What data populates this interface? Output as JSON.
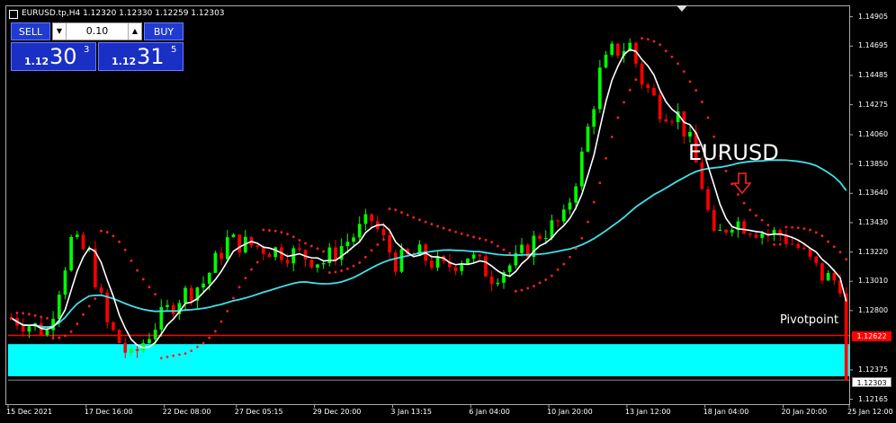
{
  "header": {
    "symbol_line": "EURUSD.tp,H4  1.12320 1.12330 1.12259 1.12303"
  },
  "trade_panel": {
    "sell_label": "SELL",
    "buy_label": "BUY",
    "lot_value": "0.10",
    "sell_price": {
      "small": "1.12",
      "big": "30",
      "sup": "3"
    },
    "buy_price": {
      "small": "1.12",
      "big": "31",
      "sup": "5"
    }
  },
  "overlay": {
    "title": "EURUSD",
    "pivot_label": "Pivotpoint",
    "arrow_icon": "down-arrow-icon",
    "red_tag": "1.12622",
    "white_tag": "1.12303"
  },
  "colors": {
    "background": "#000000",
    "bull_candle": "#00ff00",
    "bear_candle": "#ff0000",
    "fast_ma": "#ffffff",
    "slow_ma": "#40e0e8",
    "sar": "#ff2020",
    "pivot_line": "#ff0000",
    "zone": "#00ffff"
  },
  "chart_data": {
    "type": "candlestick",
    "title": "EURUSD.tp,H4",
    "y_ticks": [
      "1.14905",
      "1.14695",
      "1.14485",
      "1.14275",
      "1.14060",
      "1.13850",
      "1.13640",
      "1.13430",
      "1.13220",
      "1.13010",
      "1.12800",
      "1.12375",
      "1.12165"
    ],
    "x_ticks": [
      "15 Dec 2021",
      "17 Dec 16:00",
      "22 Dec 08:00",
      "27 Dec 05:15",
      "29 Dec 20:00",
      "3 Jan 13:15",
      "6 Jan 04:00",
      "10 Jan 20:00",
      "13 Jan 12:00",
      "18 Jan 04:00",
      "20 Jan 20:00",
      "25 Jan 12:00"
    ],
    "ylim": [
      1.1213,
      1.1498
    ],
    "n_bars": 140,
    "close_path": [
      [
        0,
        1.1275
      ],
      [
        6,
        1.1265
      ],
      [
        10,
        1.133
      ],
      [
        13,
        1.132
      ],
      [
        16,
        1.127
      ],
      [
        20,
        1.1245
      ],
      [
        24,
        1.127
      ],
      [
        28,
        1.129
      ],
      [
        32,
        1.13
      ],
      [
        36,
        1.133
      ],
      [
        42,
        1.1325
      ],
      [
        48,
        1.132
      ],
      [
        52,
        1.1315
      ],
      [
        56,
        1.133
      ],
      [
        60,
        1.1345
      ],
      [
        64,
        1.1315
      ],
      [
        68,
        1.132
      ],
      [
        72,
        1.131
      ],
      [
        76,
        1.132
      ],
      [
        80,
        1.1305
      ],
      [
        84,
        1.1315
      ],
      [
        88,
        1.1335
      ],
      [
        92,
        1.1345
      ],
      [
        95,
        1.139
      ],
      [
        98,
        1.145
      ],
      [
        100,
        1.1465
      ],
      [
        103,
        1.147
      ],
      [
        105,
        1.1445
      ],
      [
        108,
        1.1425
      ],
      [
        111,
        1.142
      ],
      [
        113,
        1.14
      ],
      [
        115,
        1.137
      ],
      [
        117,
        1.133
      ],
      [
        120,
        1.1345
      ],
      [
        123,
        1.134
      ],
      [
        126,
        1.1335
      ],
      [
        128,
        1.1335
      ],
      [
        131,
        1.1325
      ],
      [
        133,
        1.1315
      ],
      [
        135,
        1.1305
      ],
      [
        138,
        1.13
      ],
      [
        140,
        1.1285
      ]
    ],
    "last_bar_close": 1.12303,
    "pivot_level": 1.12622,
    "zone_range": [
      1.1233,
      1.1256
    ]
  }
}
